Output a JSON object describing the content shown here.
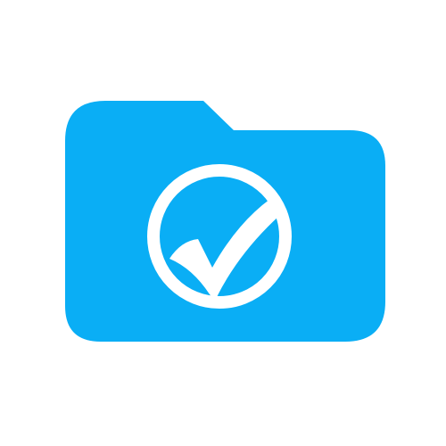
{
  "icon": {
    "name": "folder-check-icon",
    "folder_color": "#0AAEF5",
    "mark_color": "#FFFFFF",
    "background_color": "#FFFFFF"
  }
}
